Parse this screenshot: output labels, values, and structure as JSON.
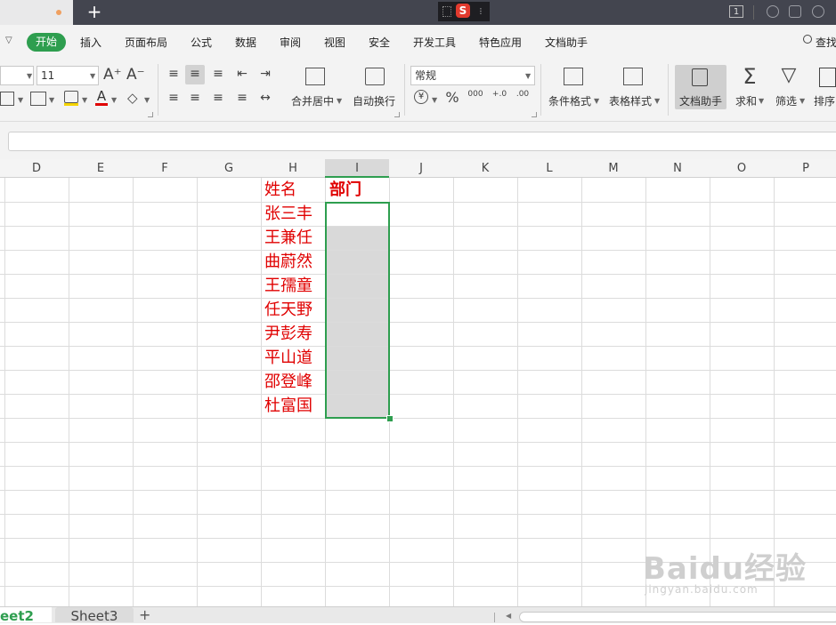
{
  "titlebar": {
    "new_tab_label": "+",
    "ime_badge": "S",
    "window_count": "1"
  },
  "menu": {
    "items": [
      "开始",
      "插入",
      "页面布局",
      "公式",
      "数据",
      "审阅",
      "视图",
      "安全",
      "开发工具",
      "特色应用",
      "文档助手"
    ],
    "search_label": "查找"
  },
  "ribbon": {
    "font_size": "11",
    "font_grow": "A⁺",
    "font_shrink": "A⁻",
    "merge_center_label": "合并居中",
    "wrap_text_label": "自动换行",
    "number_format": "常规",
    "currency_symbol": "¥",
    "percent_symbol": "%",
    "thousands_symbol": "000",
    "decimal_increase": "+.0",
    "decimal_decrease": ".00",
    "conditional_format_label": "条件格式",
    "table_style_label": "表格样式",
    "doc_helper_label": "文档助手",
    "sum_label": "求和",
    "filter_label": "筛选",
    "sort_label": "排序"
  },
  "grid": {
    "columns": [
      "D",
      "E",
      "F",
      "G",
      "H",
      "I",
      "J",
      "K",
      "L",
      "M",
      "N",
      "O",
      "P"
    ],
    "header_name": "姓名",
    "header_dept": "部门",
    "names": [
      "张三丰",
      "王兼任",
      "曲蔚然",
      "王孺童",
      "任天野",
      "尹彭寿",
      "平山道",
      "邵登峰",
      "杜富国"
    ]
  },
  "sheets": {
    "active": "eet2",
    "other": "Sheet3",
    "add": "+"
  },
  "watermark": {
    "logo": "Baidu经验",
    "sub": "jingyan.baidu.com"
  },
  "colors": {
    "accent": "#2e9e4f",
    "cell_text": "#e00000",
    "titlebar": "#43454f"
  }
}
